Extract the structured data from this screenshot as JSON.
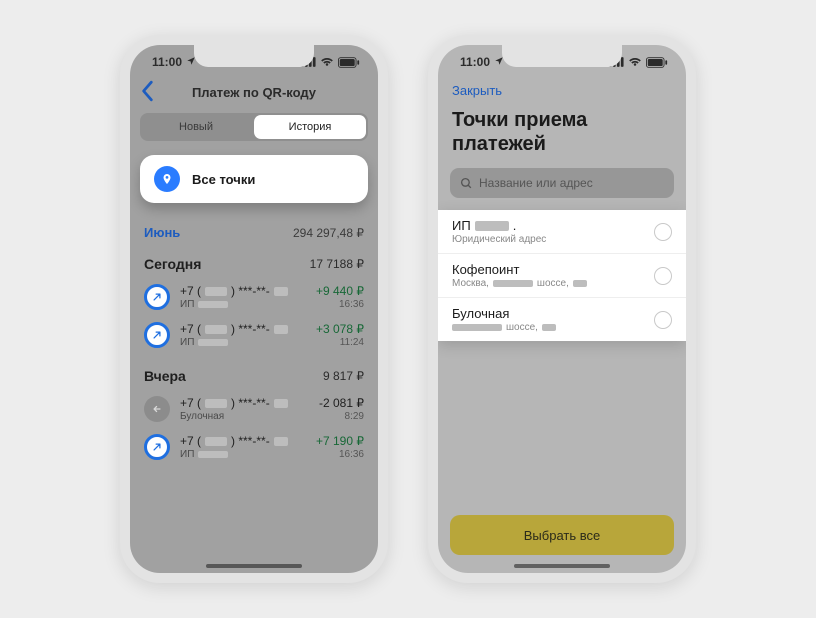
{
  "status": {
    "time": "11:00"
  },
  "left": {
    "nav_title": "Платеж по QR-коду",
    "tabs": {
      "new": "Новый",
      "history": "История"
    },
    "card": {
      "label": "Все точки"
    },
    "month": {
      "name": "Июнь",
      "total": "294 297,48 ₽"
    },
    "groups": [
      {
        "name": "Сегодня",
        "total": "17 7188 ₽",
        "txns": [
          {
            "icon": "blue",
            "phone": "+7 (",
            "phone2": ") ***-**-",
            "sub_pre": "ИП",
            "amount": "+9 440 ₽",
            "amt_class": "pos",
            "time": "16:36"
          },
          {
            "icon": "blue",
            "phone": "+7 (",
            "phone2": ") ***-**-",
            "sub_pre": "ИП",
            "amount": "+3 078 ₽",
            "amt_class": "pos",
            "time": "11:24"
          }
        ]
      },
      {
        "name": "Вчера",
        "total": "9 817 ₽",
        "txns": [
          {
            "icon": "gray",
            "phone": "+7 (",
            "phone2": ") ***-**-",
            "sub_pre": "Булочная",
            "amount": "-2 081 ₽",
            "amt_class": "neg",
            "time": "8:29"
          },
          {
            "icon": "blue",
            "phone": "+7 (",
            "phone2": ") ***-**-",
            "sub_pre": "ИП",
            "amount": "+7 190 ₽",
            "amt_class": "pos",
            "time": "16:36"
          }
        ]
      }
    ]
  },
  "right": {
    "close": "Закрыть",
    "title": "Точки приема платежей",
    "search_placeholder": "Название или адрес",
    "options": [
      {
        "title_pre": "ИП",
        "title_blur": true,
        "title_post": ".",
        "sub_pre": "Юридический адрес",
        "sub_blur1": false
      },
      {
        "title_pre": "Кофепоинт",
        "title_blur": false,
        "title_post": "",
        "sub_pre": "Москва,",
        "sub_mid": "шоссе,",
        "sub_blur1": true
      },
      {
        "title_pre": "Булочная",
        "title_blur": false,
        "title_post": "",
        "sub_pre": "",
        "sub_mid": "шоссе,",
        "sub_blur1": true
      }
    ],
    "button": "Выбрать все"
  }
}
